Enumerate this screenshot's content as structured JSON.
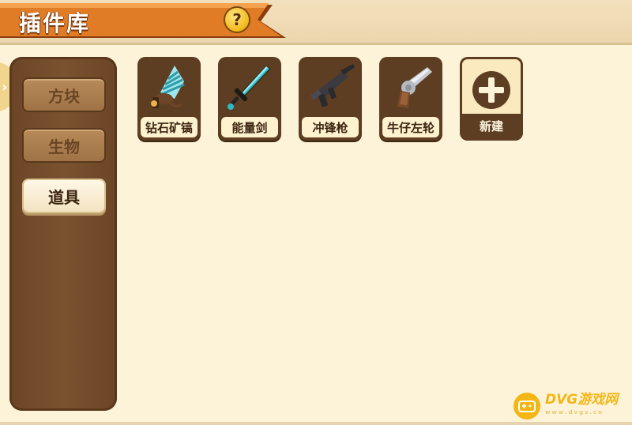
{
  "header": {
    "title": "插件库",
    "help_symbol": "?"
  },
  "edge_tab": {
    "symbol": "›"
  },
  "sidebar": {
    "categories": [
      {
        "label": "方块",
        "active": false
      },
      {
        "label": "生物",
        "active": false
      },
      {
        "label": "道具",
        "active": true
      }
    ]
  },
  "items": [
    {
      "label": "钻石矿镐",
      "icon": "drill-icon"
    },
    {
      "label": "能量剑",
      "icon": "sword-icon"
    },
    {
      "label": "冲锋枪",
      "icon": "smg-icon"
    },
    {
      "label": "牛仔左轮",
      "icon": "revolver-icon"
    }
  ],
  "new_item": {
    "label": "新建",
    "icon": "plus-icon"
  },
  "watermark": {
    "brand": "DVG游戏网",
    "domain": "www.dvgs.cn"
  },
  "colors": {
    "banner": "#e07b26",
    "sidebar": "#7a5230",
    "background": "#fdf3d8",
    "accent_gold": "#f2b818"
  }
}
